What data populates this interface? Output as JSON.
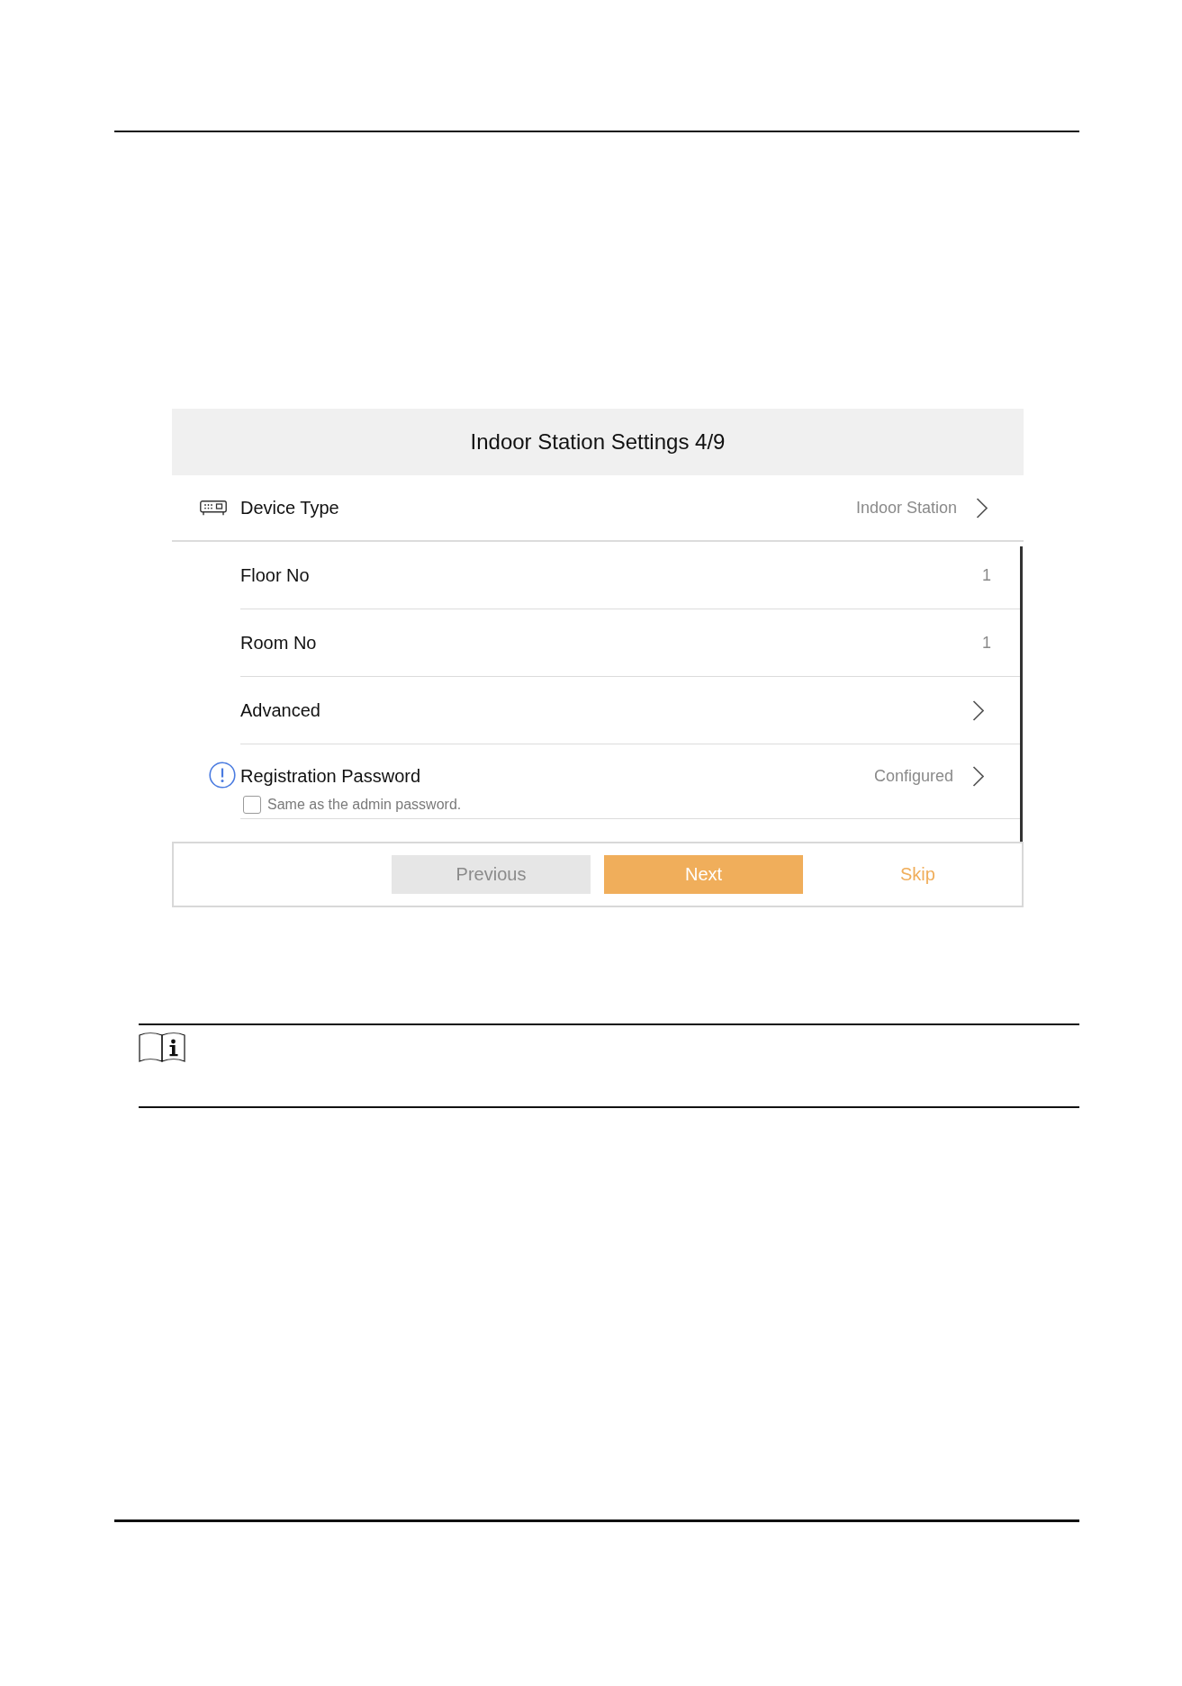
{
  "wizard": {
    "title": "Indoor Station Settings 4/9",
    "rows": [
      {
        "kind": "device",
        "label": "Device Type",
        "value": "Indoor Station"
      },
      {
        "kind": "number",
        "label": "Floor No",
        "value": "1"
      },
      {
        "kind": "number",
        "label": "Room No",
        "value": "1"
      },
      {
        "kind": "link",
        "label": "Advanced"
      },
      {
        "kind": "password",
        "label": "Registration Password",
        "value": "Configured",
        "option": {
          "label": "Same as the admin password.",
          "checked": false
        }
      }
    ],
    "buttons": [
      {
        "kind": "secondary",
        "label": "Previous"
      },
      {
        "kind": "primary",
        "label": "Next"
      },
      {
        "kind": "text",
        "label": "Skip"
      }
    ]
  }
}
